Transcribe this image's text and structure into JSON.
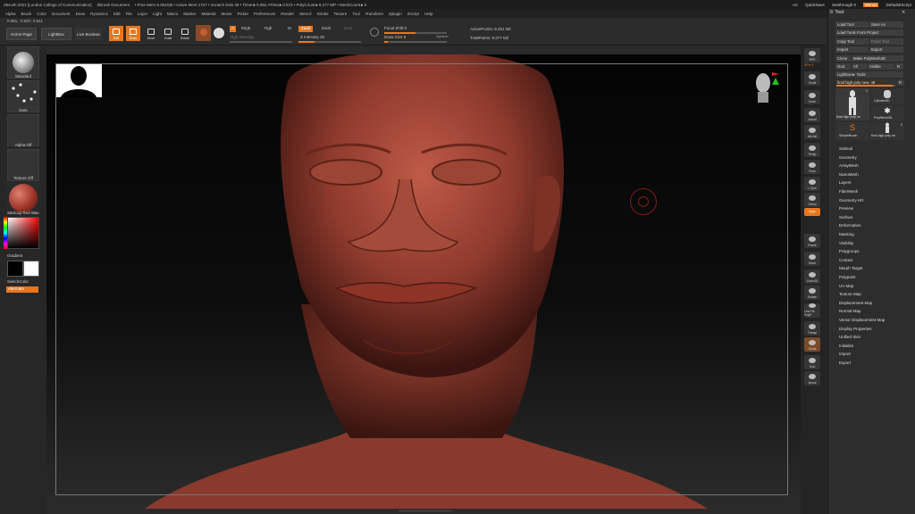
{
  "titlebar": {
    "app": "ZBrush 2021 [London College of Communication]",
    "doc": "ZBrush Document",
    "stats": "• Free Mem 6.064GB • Active Mem 1727 • Scratch Disk 49 • Timer►0.062 ATime►0.572 • PolyCount►9.277 MP • MeshCount►3",
    "ac": "AC",
    "quicksave": "QuickSave",
    "seethrough": "Seethrough 0",
    "menus": "Menus",
    "defaultzscript": "DefaultZScript"
  },
  "menubar": [
    "Alpha",
    "Brush",
    "Color",
    "Document",
    "Draw",
    "Dynamics",
    "Edit",
    "File",
    "Layer",
    "Light",
    "Macro",
    "Marker",
    "Material",
    "Movie",
    "Picker",
    "Preferences",
    "Render",
    "Stencil",
    "Stroke",
    "Texture",
    "Tool",
    "Transform",
    "Zplugin",
    "Zscript",
    "Help"
  ],
  "shelf": {
    "coords": "0.081, -0.837, 0.511",
    "home_page": "Home Page",
    "lightbox": "LightBox",
    "live_boolean": "Live Boolean",
    "edit": "Edit",
    "draw": "Draw",
    "move": "Move",
    "scale": "Scale",
    "rotate": "Rotate",
    "a": "A",
    "mrgb": "Mrgb",
    "rgb": "Rgb",
    "m": "M",
    "zadd": "Zadd",
    "zsub": "Zsub",
    "zcut": "Zcut",
    "rgb_intensity": "Rgb Intensity",
    "z_intensity": "Z Intensity 25",
    "z_intensity_value": 25,
    "focal_shift": "Focal Shift 0",
    "draw_size": "Draw Size 5",
    "dynamic": "Dynamic",
    "active_points": "ActivePoints: 9.261 Mil",
    "total_points": "TotalPoints: 9.277 Mil"
  },
  "leftcol": {
    "standard": "Standard",
    "dots": "Dots",
    "alpha_off": "Alpha Off",
    "texture_off": "Texture Off",
    "material": "MatCap Red Wax",
    "gradient": "Gradient",
    "switchcolor": "SwitchColor",
    "alternate": "Alternate"
  },
  "righttb": {
    "bpr": "BPR",
    "spix": "SPix 3",
    "scroll": "Scroll",
    "zoom": "Zoom",
    "actual": "Actual",
    "aahalf": "AAHalf",
    "persp": "Persp",
    "floor": "Floor",
    "local": "L.Sym",
    "gizmo": "Gizmo",
    "xyz": "Qxyz",
    "frame": "Frame",
    "move": "Move",
    "zoom3d": "Zoom3D",
    "rotate": "Rotate",
    "line_fill": "Line Fill PolyF",
    "transp": "Transp",
    "ghost": "Ghost",
    "solo": "Solo",
    "xpose": "Xpose"
  },
  "tool": {
    "title": "Tool",
    "load_tool": "Load Tool",
    "save_as": "Save As",
    "load_from_project": "Load Tools From Project",
    "copy_tool": "Copy Tool",
    "paste_tool": "Paste Tool",
    "import": "Import",
    "export": "Export",
    "clone": "Clone",
    "make_polymesh": "Make PolyMesh3D",
    "goz": "GoZ",
    "all": "All",
    "visible": "Visible",
    "r": "R",
    "lightbox_tools": "Lightbox► Tools",
    "current_tool": "final high poly new. 48",
    "r2": "R",
    "thumbs": [
      {
        "label": "final high poly ne",
        "badge": "2"
      },
      {
        "label": "Cylinder3D",
        "badge": ""
      },
      {
        "label": "PolyMesh3D",
        "badge": ""
      },
      {
        "label": "SimpleBrush",
        "badge": ""
      },
      {
        "label": "final high poly ne",
        "badge": "2"
      }
    ],
    "subpalettes": [
      "Subtool",
      "Geometry",
      "ArrayMesh",
      "NanoMesh",
      "Layers",
      "FiberMesh",
      "Geometry HD",
      "Preview",
      "Surface",
      "Deformation",
      "Masking",
      "Visibility",
      "Polygroups",
      "Contact",
      "Morph Target",
      "Polypaint",
      "UV Map",
      "Texture Map",
      "Displacement Map",
      "Normal Map",
      "Vector Displacement Map",
      "Display Properties",
      "Unified Skin",
      "Initialize",
      "Import",
      "Export"
    ]
  },
  "colors": {
    "accent": "#e8771e",
    "skin": "#a4483a",
    "panel": "#2d2d2d"
  }
}
